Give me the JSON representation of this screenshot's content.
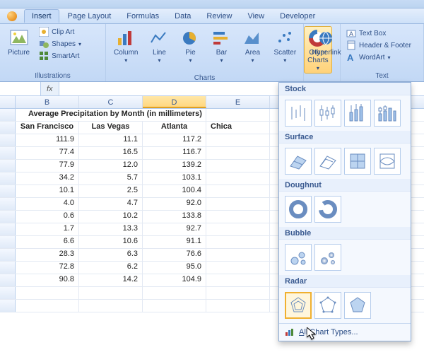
{
  "tabs": {
    "home": "",
    "insert": "Insert",
    "pagelayout": "Page Layout",
    "formulas": "Formulas",
    "data": "Data",
    "review": "Review",
    "view": "View",
    "developer": "Developer"
  },
  "ribbon": {
    "illustrations": {
      "label": "Illustrations",
      "picture": "Picture",
      "clipart": "Clip Art",
      "shapes": "Shapes",
      "smartart": "SmartArt"
    },
    "charts": {
      "label": "Charts",
      "column": "Column",
      "line": "Line",
      "pie": "Pie",
      "bar": "Bar",
      "area": "Area",
      "scatter": "Scatter",
      "other": "Other\nCharts"
    },
    "links": {
      "label": "",
      "hyperlink": "Hyperlink"
    },
    "text": {
      "label": "Text",
      "textbox": "Text Box",
      "headerfooter": "Header & Footer",
      "wordart": "WordArt"
    }
  },
  "fx_symbol": "fx",
  "columns": {
    "b": "B",
    "c": "C",
    "d": "D",
    "e": "E"
  },
  "sheet": {
    "title": "Average Precipitation by Month (in millimeters)",
    "headers": {
      "b": "San Francisco",
      "c": "Las Vegas",
      "d": "Atlanta",
      "e": "Chica"
    },
    "rows": [
      {
        "b": "111.9",
        "c": "11.1",
        "d": "117.2"
      },
      {
        "b": "77.4",
        "c": "16.5",
        "d": "116.7"
      },
      {
        "b": "77.9",
        "c": "12.0",
        "d": "139.2"
      },
      {
        "b": "34.2",
        "c": "5.7",
        "d": "103.1"
      },
      {
        "b": "10.1",
        "c": "2.5",
        "d": "100.4"
      },
      {
        "b": "4.0",
        "c": "4.7",
        "d": "92.0"
      },
      {
        "b": "0.6",
        "c": "10.2",
        "d": "133.8"
      },
      {
        "b": "1.7",
        "c": "13.3",
        "d": "92.7"
      },
      {
        "b": "6.6",
        "c": "10.6",
        "d": "91.1"
      },
      {
        "b": "28.3",
        "c": "6.3",
        "d": "76.6"
      },
      {
        "b": "72.8",
        "c": "6.2",
        "d": "95.0"
      },
      {
        "b": "90.8",
        "c": "14.2",
        "d": "104.9"
      }
    ]
  },
  "dropdown": {
    "stock": "Stock",
    "surface": "Surface",
    "doughnut": "Doughnut",
    "bubble": "Bubble",
    "radar": "Radar",
    "allcharts": "All Chart Types..."
  }
}
